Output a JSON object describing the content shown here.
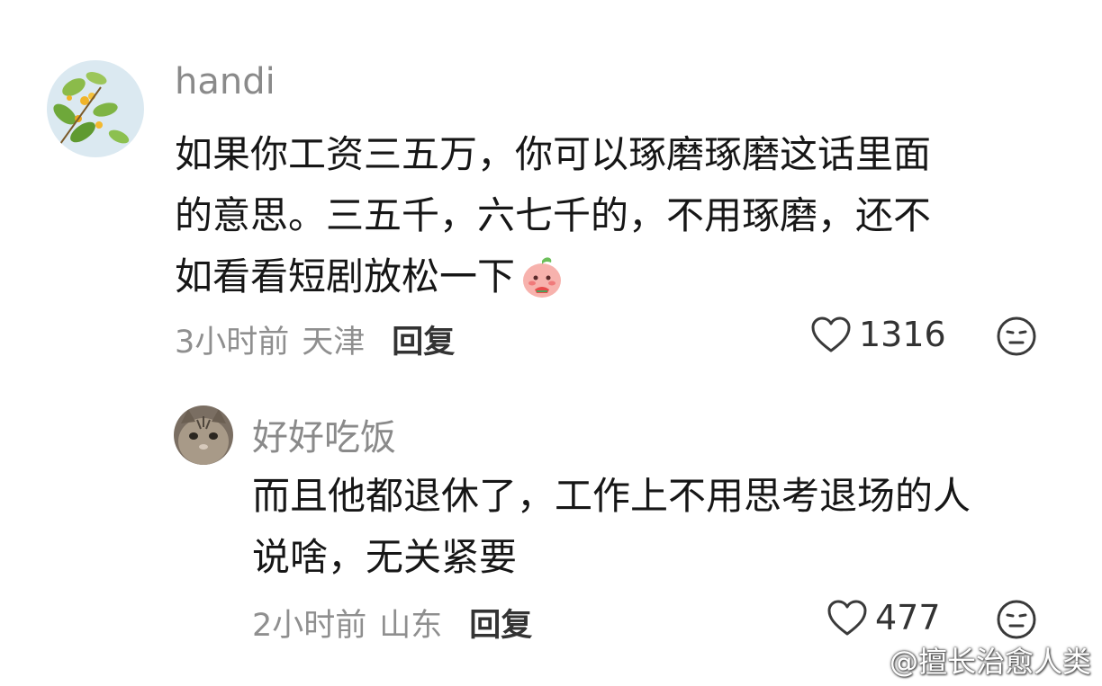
{
  "comments": [
    {
      "username": "handi",
      "content_lines": [
        "如果你工资三五万，你可以琢磨琢磨这话里面",
        "的意思。三五千，六七千的，不用琢磨，还不",
        "如看看短剧放松一下"
      ],
      "time": "3小时前",
      "location": "天津",
      "reply_label": "回复",
      "likes": "1316"
    },
    {
      "username": "好好吃饭",
      "content_lines": [
        "而且他都退休了，工作上不用思考退场的人",
        "说啥，无关紧要"
      ],
      "time": "2小时前",
      "location": "山东",
      "reply_label": "回复",
      "likes": "477"
    }
  ],
  "watermark": "@擅长治愈人类",
  "icons": {
    "like": "heart-outline-icon",
    "dislike": "meh-face-icon",
    "weibo": "weibo-logo-icon"
  }
}
